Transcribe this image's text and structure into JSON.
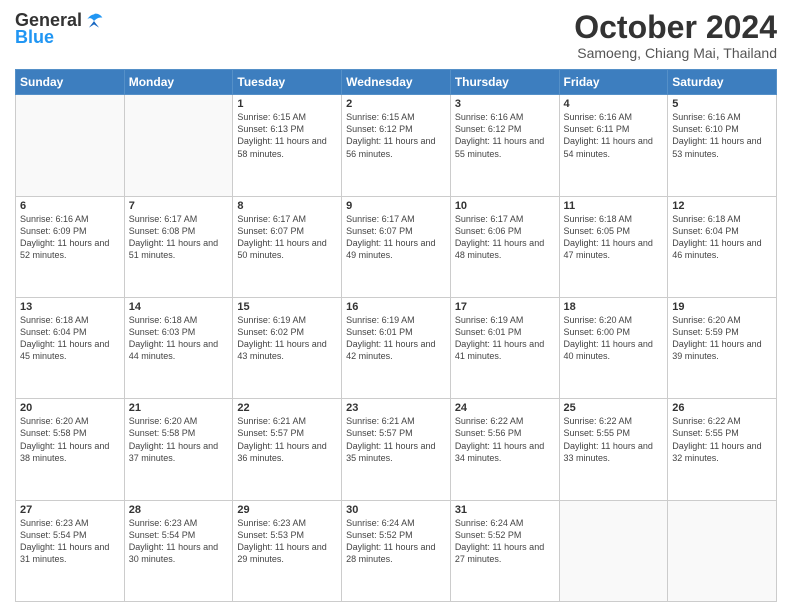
{
  "header": {
    "logo": {
      "general": "General",
      "blue": "Blue"
    },
    "title": "October 2024",
    "subtitle": "Samoeng, Chiang Mai, Thailand"
  },
  "weekdays": [
    "Sunday",
    "Monday",
    "Tuesday",
    "Wednesday",
    "Thursday",
    "Friday",
    "Saturday"
  ],
  "weeks": [
    [
      {
        "day": "",
        "info": ""
      },
      {
        "day": "",
        "info": ""
      },
      {
        "day": "1",
        "info": "Sunrise: 6:15 AM\nSunset: 6:13 PM\nDaylight: 11 hours and 58 minutes."
      },
      {
        "day": "2",
        "info": "Sunrise: 6:15 AM\nSunset: 6:12 PM\nDaylight: 11 hours and 56 minutes."
      },
      {
        "day": "3",
        "info": "Sunrise: 6:16 AM\nSunset: 6:12 PM\nDaylight: 11 hours and 55 minutes."
      },
      {
        "day": "4",
        "info": "Sunrise: 6:16 AM\nSunset: 6:11 PM\nDaylight: 11 hours and 54 minutes."
      },
      {
        "day": "5",
        "info": "Sunrise: 6:16 AM\nSunset: 6:10 PM\nDaylight: 11 hours and 53 minutes."
      }
    ],
    [
      {
        "day": "6",
        "info": "Sunrise: 6:16 AM\nSunset: 6:09 PM\nDaylight: 11 hours and 52 minutes."
      },
      {
        "day": "7",
        "info": "Sunrise: 6:17 AM\nSunset: 6:08 PM\nDaylight: 11 hours and 51 minutes."
      },
      {
        "day": "8",
        "info": "Sunrise: 6:17 AM\nSunset: 6:07 PM\nDaylight: 11 hours and 50 minutes."
      },
      {
        "day": "9",
        "info": "Sunrise: 6:17 AM\nSunset: 6:07 PM\nDaylight: 11 hours and 49 minutes."
      },
      {
        "day": "10",
        "info": "Sunrise: 6:17 AM\nSunset: 6:06 PM\nDaylight: 11 hours and 48 minutes."
      },
      {
        "day": "11",
        "info": "Sunrise: 6:18 AM\nSunset: 6:05 PM\nDaylight: 11 hours and 47 minutes."
      },
      {
        "day": "12",
        "info": "Sunrise: 6:18 AM\nSunset: 6:04 PM\nDaylight: 11 hours and 46 minutes."
      }
    ],
    [
      {
        "day": "13",
        "info": "Sunrise: 6:18 AM\nSunset: 6:04 PM\nDaylight: 11 hours and 45 minutes."
      },
      {
        "day": "14",
        "info": "Sunrise: 6:18 AM\nSunset: 6:03 PM\nDaylight: 11 hours and 44 minutes."
      },
      {
        "day": "15",
        "info": "Sunrise: 6:19 AM\nSunset: 6:02 PM\nDaylight: 11 hours and 43 minutes."
      },
      {
        "day": "16",
        "info": "Sunrise: 6:19 AM\nSunset: 6:01 PM\nDaylight: 11 hours and 42 minutes."
      },
      {
        "day": "17",
        "info": "Sunrise: 6:19 AM\nSunset: 6:01 PM\nDaylight: 11 hours and 41 minutes."
      },
      {
        "day": "18",
        "info": "Sunrise: 6:20 AM\nSunset: 6:00 PM\nDaylight: 11 hours and 40 minutes."
      },
      {
        "day": "19",
        "info": "Sunrise: 6:20 AM\nSunset: 5:59 PM\nDaylight: 11 hours and 39 minutes."
      }
    ],
    [
      {
        "day": "20",
        "info": "Sunrise: 6:20 AM\nSunset: 5:58 PM\nDaylight: 11 hours and 38 minutes."
      },
      {
        "day": "21",
        "info": "Sunrise: 6:20 AM\nSunset: 5:58 PM\nDaylight: 11 hours and 37 minutes."
      },
      {
        "day": "22",
        "info": "Sunrise: 6:21 AM\nSunset: 5:57 PM\nDaylight: 11 hours and 36 minutes."
      },
      {
        "day": "23",
        "info": "Sunrise: 6:21 AM\nSunset: 5:57 PM\nDaylight: 11 hours and 35 minutes."
      },
      {
        "day": "24",
        "info": "Sunrise: 6:22 AM\nSunset: 5:56 PM\nDaylight: 11 hours and 34 minutes."
      },
      {
        "day": "25",
        "info": "Sunrise: 6:22 AM\nSunset: 5:55 PM\nDaylight: 11 hours and 33 minutes."
      },
      {
        "day": "26",
        "info": "Sunrise: 6:22 AM\nSunset: 5:55 PM\nDaylight: 11 hours and 32 minutes."
      }
    ],
    [
      {
        "day": "27",
        "info": "Sunrise: 6:23 AM\nSunset: 5:54 PM\nDaylight: 11 hours and 31 minutes."
      },
      {
        "day": "28",
        "info": "Sunrise: 6:23 AM\nSunset: 5:54 PM\nDaylight: 11 hours and 30 minutes."
      },
      {
        "day": "29",
        "info": "Sunrise: 6:23 AM\nSunset: 5:53 PM\nDaylight: 11 hours and 29 minutes."
      },
      {
        "day": "30",
        "info": "Sunrise: 6:24 AM\nSunset: 5:52 PM\nDaylight: 11 hours and 28 minutes."
      },
      {
        "day": "31",
        "info": "Sunrise: 6:24 AM\nSunset: 5:52 PM\nDaylight: 11 hours and 27 minutes."
      },
      {
        "day": "",
        "info": ""
      },
      {
        "day": "",
        "info": ""
      }
    ]
  ]
}
